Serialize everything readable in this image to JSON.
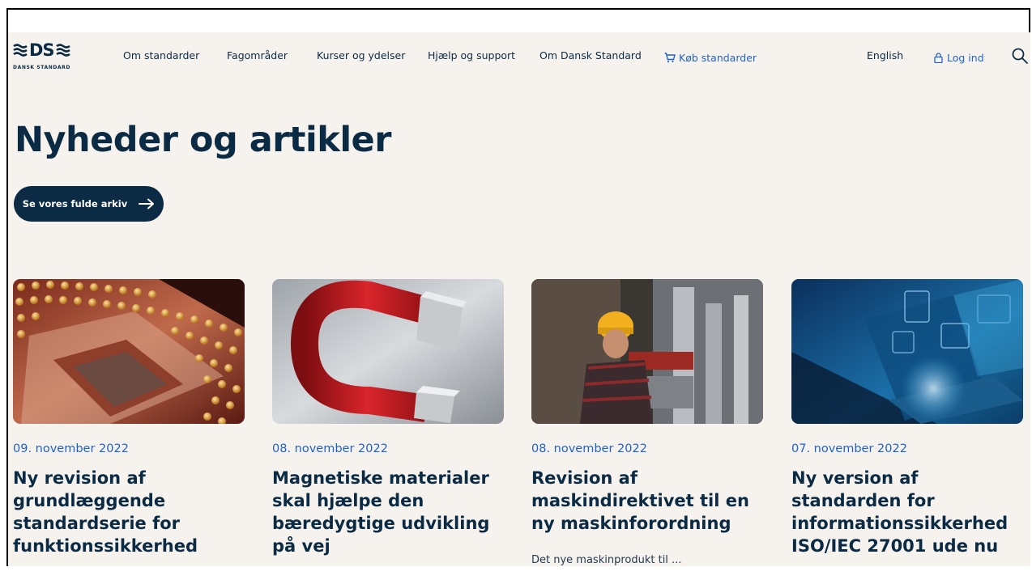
{
  "brand": {
    "logo_text": "DS",
    "logo_subtitle": "DANSK STANDARD"
  },
  "nav": {
    "items": [
      "Om standarder",
      "Fagområder",
      "Kurser og ydelser",
      "Hjælp og support",
      "Om Dansk Standard"
    ],
    "buy_label": "Køb standarder",
    "language_label": "English",
    "login_label": "Log ind"
  },
  "page": {
    "title": "Nyheder og artikler",
    "archive_button": "Se vores fulde arkiv"
  },
  "articles": [
    {
      "date": "09. november 2022",
      "title": "Ny revision af grundlæggende standardserie for funktionssikkerhed",
      "image": "microchip-image"
    },
    {
      "date": "08. november 2022",
      "title": "Magnetiske materialer skal hjælpe den bæredygtige udvikling på vej",
      "image": "magnet-image"
    },
    {
      "date": "08. november 2022",
      "title": "Revision af maskindirektivet til en ny maskinforordning",
      "snippet": "Det nye maskinprodukt til ...",
      "image": "engineer-image"
    },
    {
      "date": "07. november 2022",
      "title": "Ny version af standarden for informationssikkerhed ISO/IEC 27001 ude nu",
      "image": "laptop-security-image"
    }
  ],
  "colors": {
    "navy": "#0b2a43",
    "link_blue": "#1f62c9",
    "page_bg": "#f6f3ef"
  }
}
